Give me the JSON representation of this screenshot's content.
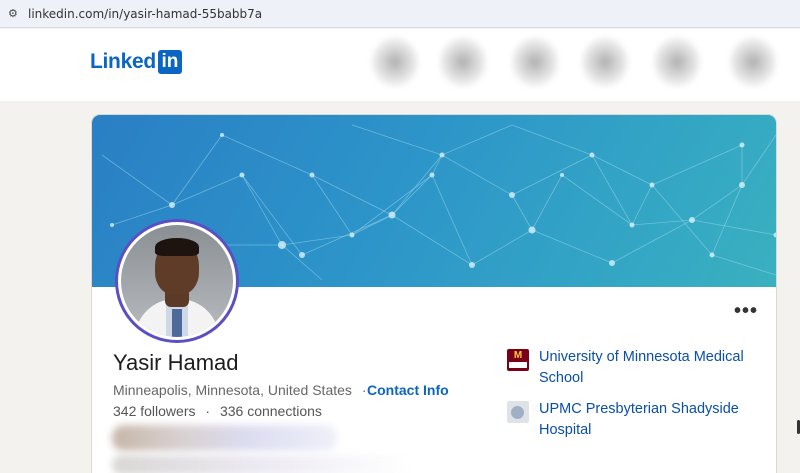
{
  "browser": {
    "url": "linkedin.com/in/yasir-hamad-55babb7a",
    "site_info_icon": "tune-icon"
  },
  "header": {
    "logo_text": "Linked",
    "logo_badge": "in"
  },
  "profile": {
    "name": "Yasir Hamad",
    "location": "Minneapolis, Minnesota, United States",
    "separator": "·",
    "contact_info": "Contact Info",
    "followers": "342 followers",
    "connections": "336 connections",
    "more_label": "•••"
  },
  "organizations": [
    {
      "name": "University of Minnesota Medical School",
      "logo": "umn-medical-school-logo",
      "logo_text": "M"
    },
    {
      "name": "UPMC Presbyterian Shadyside Hospital",
      "logo": "upmc-logo"
    }
  ],
  "colors": {
    "brand": "#0a66c2",
    "banner_start": "#2a7fc4",
    "banner_end": "#3ab0bf",
    "link": "#0a4fa6"
  }
}
